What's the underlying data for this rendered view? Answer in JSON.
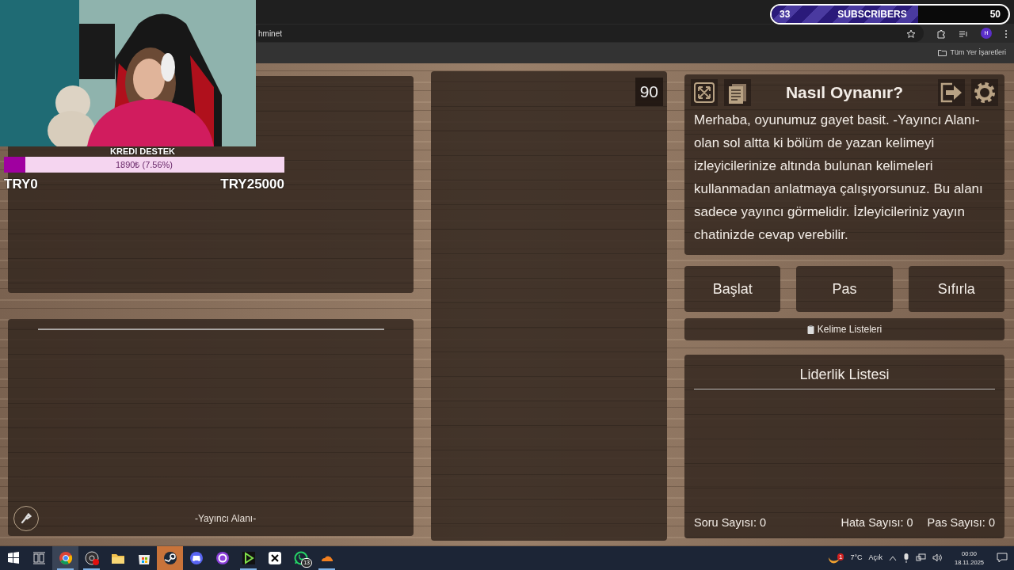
{
  "browser": {
    "address_text": "hminet",
    "profile_initial": "H",
    "bookmarks_folder": "Tüm Yer İşaretleri"
  },
  "webcam_overlay": {
    "kind": "picture",
    "goal_title": "KREDI DESTEK",
    "goal": {
      "level": 0.0756,
      "reading": "1890₺ (7.56%)"
    },
    "min_label": "TRY0",
    "max_label": "TRY25000"
  },
  "subscriber_goal": {
    "current": "33",
    "label": "SUBSCRIBERS",
    "target": "50",
    "level": 0.62
  },
  "timer": "90",
  "how_to_play": {
    "title": "Nasıl Oynanır?",
    "text": "Merhaba, oyunumuz gayet basit. -Yayıncı Alanı- olan sol altta ki bölüm de yazan kelimeyi izleyicilerinize altında bulunan kelimeleri kullanmadan anlatmaya çalışıyorsunuz. Bu alanı sadece yayıncı görmelidir. İzleyicileriniz yayın chatinizde cevap verebilir."
  },
  "buttons": [
    {
      "label": "Başlat"
    },
    {
      "label": "Pas"
    },
    {
      "label": "Sıfırla"
    }
  ],
  "word_lists_button": "Kelime Listeleri",
  "streamer_area_label": "-Yayıncı Alanı-",
  "leaderboard": {
    "title": "Liderlik Listesi"
  },
  "stats": [
    {
      "label": "Soru Sayısı:",
      "value": "0"
    },
    {
      "label": "Hata Sayısı:",
      "value": "0"
    },
    {
      "label": "Pas Sayısı:",
      "value": "0"
    }
  ],
  "taskbar": {
    "apps": [
      {
        "kind": "start",
        "open": false,
        "selected": false,
        "flashing": false
      },
      {
        "kind": "taskview",
        "open": false,
        "selected": false,
        "flashing": false
      },
      {
        "kind": "browser",
        "open": true,
        "selected": true,
        "flashing": false
      },
      {
        "kind": "recorder",
        "open": true,
        "selected": false,
        "flashing": false
      },
      {
        "kind": "folder",
        "open": false,
        "selected": false,
        "flashing": false
      },
      {
        "kind": "store",
        "open": false,
        "selected": false,
        "flashing": false
      },
      {
        "kind": "steam",
        "open": false,
        "selected": false,
        "flashing": true
      },
      {
        "kind": "chat",
        "open": false,
        "selected": false,
        "flashing": false
      },
      {
        "kind": "ring",
        "open": false,
        "selected": false,
        "flashing": false
      },
      {
        "kind": "play",
        "open": true,
        "selected": false,
        "flashing": false
      },
      {
        "kind": "editor",
        "open": false,
        "selected": false,
        "flashing": false
      },
      {
        "kind": "phone",
        "open": false,
        "selected": false,
        "flashing": false,
        "badge": "13"
      },
      {
        "kind": "cloud",
        "open": true,
        "selected": false,
        "flashing": false
      }
    ],
    "tray": {
      "weather_badge": "1",
      "temperature": "7°C",
      "condition": "Açık",
      "time": "00:00",
      "date": "18.11.2025"
    }
  }
}
